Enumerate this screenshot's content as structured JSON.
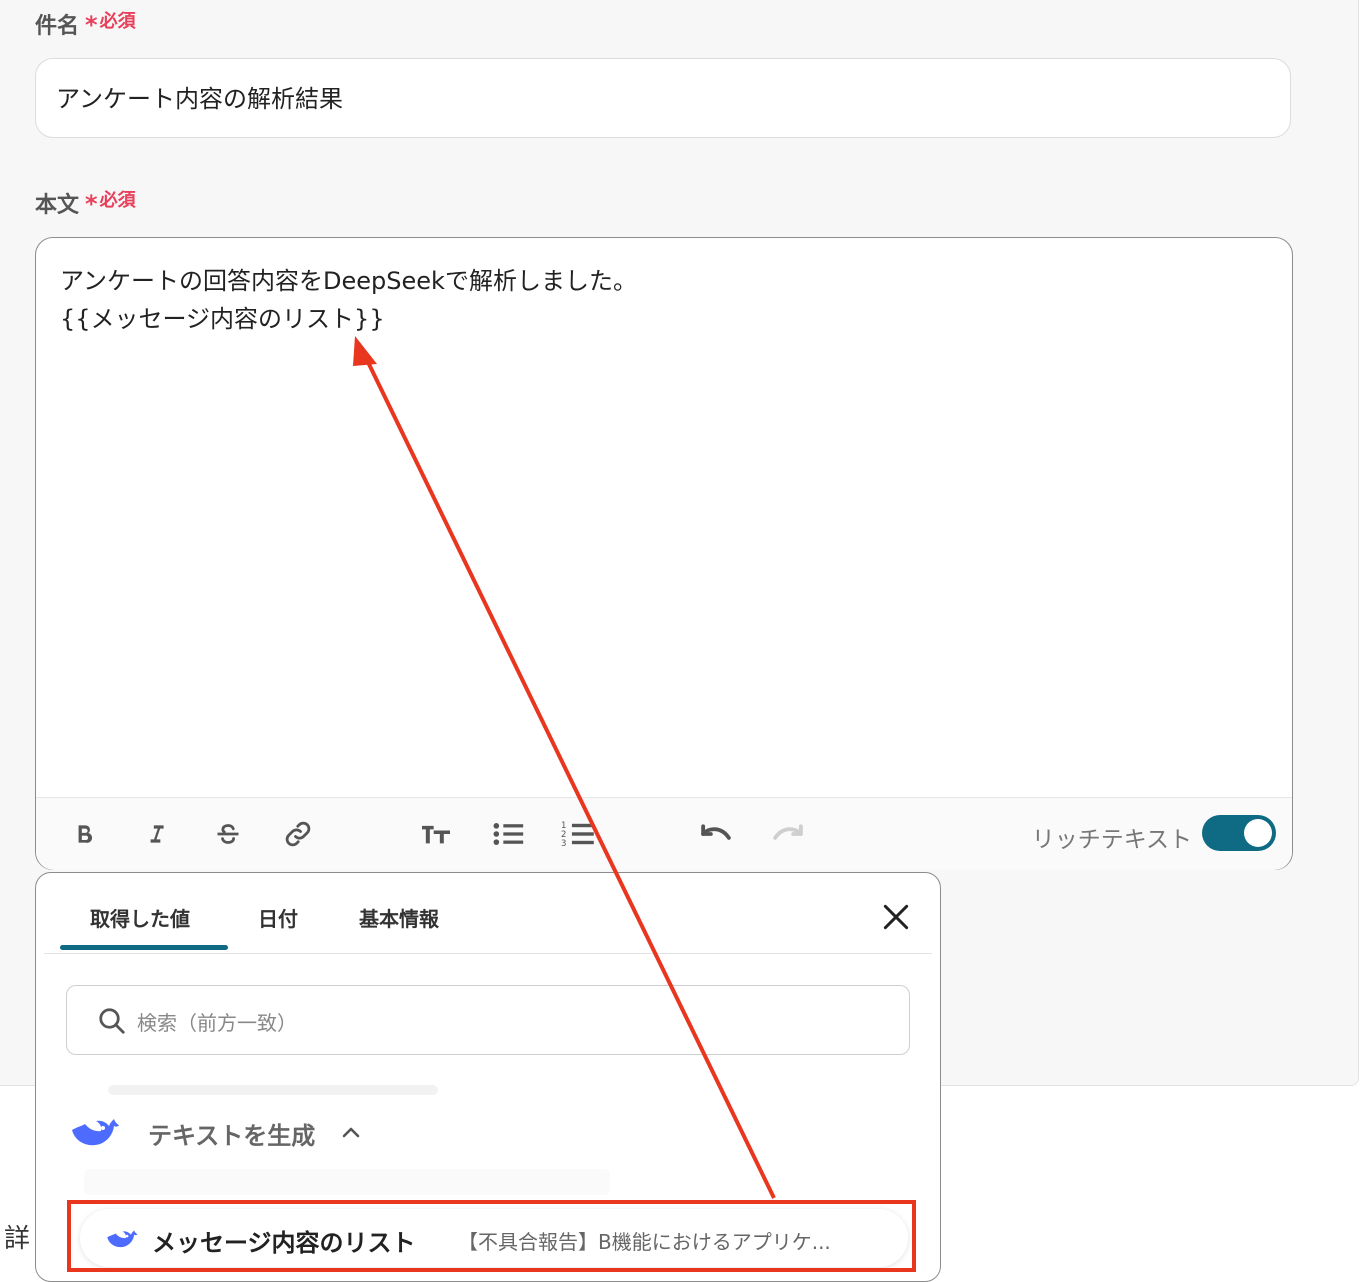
{
  "subject": {
    "label": "件名",
    "required_mark": "*",
    "required_text": "必須",
    "value": "アンケート内容の解析結果"
  },
  "body": {
    "label": "本文",
    "required_mark": "*",
    "required_text": "必須",
    "line1": "アンケートの回答内容をDeepSeekで解析しました。",
    "line2": "{{メッセージ内容のリスト}}"
  },
  "toolbar": {
    "buttons": [
      "bold-icon",
      "italic-icon",
      "strikethrough-icon",
      "link-icon",
      "text-size-icon",
      "bullet-list-icon",
      "numbered-list-icon",
      "undo-icon",
      "redo-icon"
    ],
    "rich_text_label": "リッチテキスト",
    "rich_text_enabled": true,
    "accent_color": "#0e6b83"
  },
  "popup": {
    "tabs": [
      {
        "label": "取得した値",
        "active": true
      },
      {
        "label": "日付",
        "active": false
      },
      {
        "label": "基本情報",
        "active": false
      }
    ],
    "search_placeholder": "検索（前方一致）",
    "group_label": "テキストを生成",
    "result": {
      "name": "メッセージ内容のリスト",
      "preview": "【不具合報告】B機能におけるアプリケ..."
    }
  },
  "side_label": "詳",
  "annotation_color": "#e8361f"
}
